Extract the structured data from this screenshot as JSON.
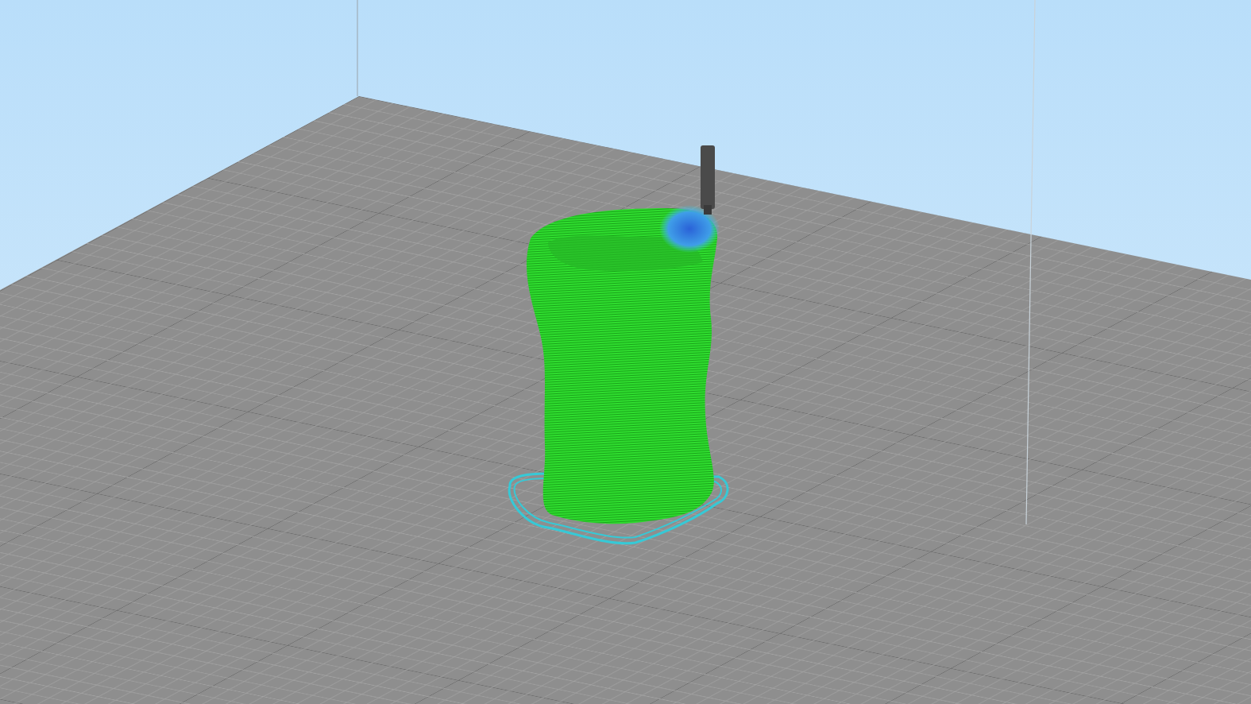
{
  "viewport": {
    "kind": "layer-view"
  }
}
